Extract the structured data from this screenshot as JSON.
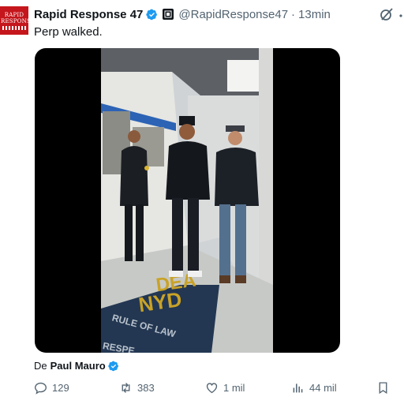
{
  "post": {
    "author": {
      "display_name": "Rapid Response 47",
      "handle": "@RapidResponse47",
      "time_sep": "·",
      "time": "13min",
      "avatar_text": "RAPID RESPONSE"
    },
    "text": "Perp walked.",
    "media": {
      "floor_text_1": "DEA",
      "floor_text_2": "NYD",
      "floor_text_3": "RULE OF LAW",
      "floor_text_4": "RESPE"
    },
    "byline": {
      "prefix": "De",
      "name": "Paul Mauro"
    },
    "actions": {
      "replies": "129",
      "reposts": "383",
      "likes": "1 mil",
      "views": "44 mil"
    }
  },
  "colors": {
    "verified": "#1d9bf0",
    "muted": "#536471",
    "text": "#0f1419",
    "avatar": "#c4161c"
  },
  "icons": [
    "verified-badge-icon",
    "affiliation-badge-icon",
    "grok-icon",
    "more-icon",
    "reply-icon",
    "repost-icon",
    "like-icon",
    "views-icon",
    "bookmark-icon"
  ]
}
